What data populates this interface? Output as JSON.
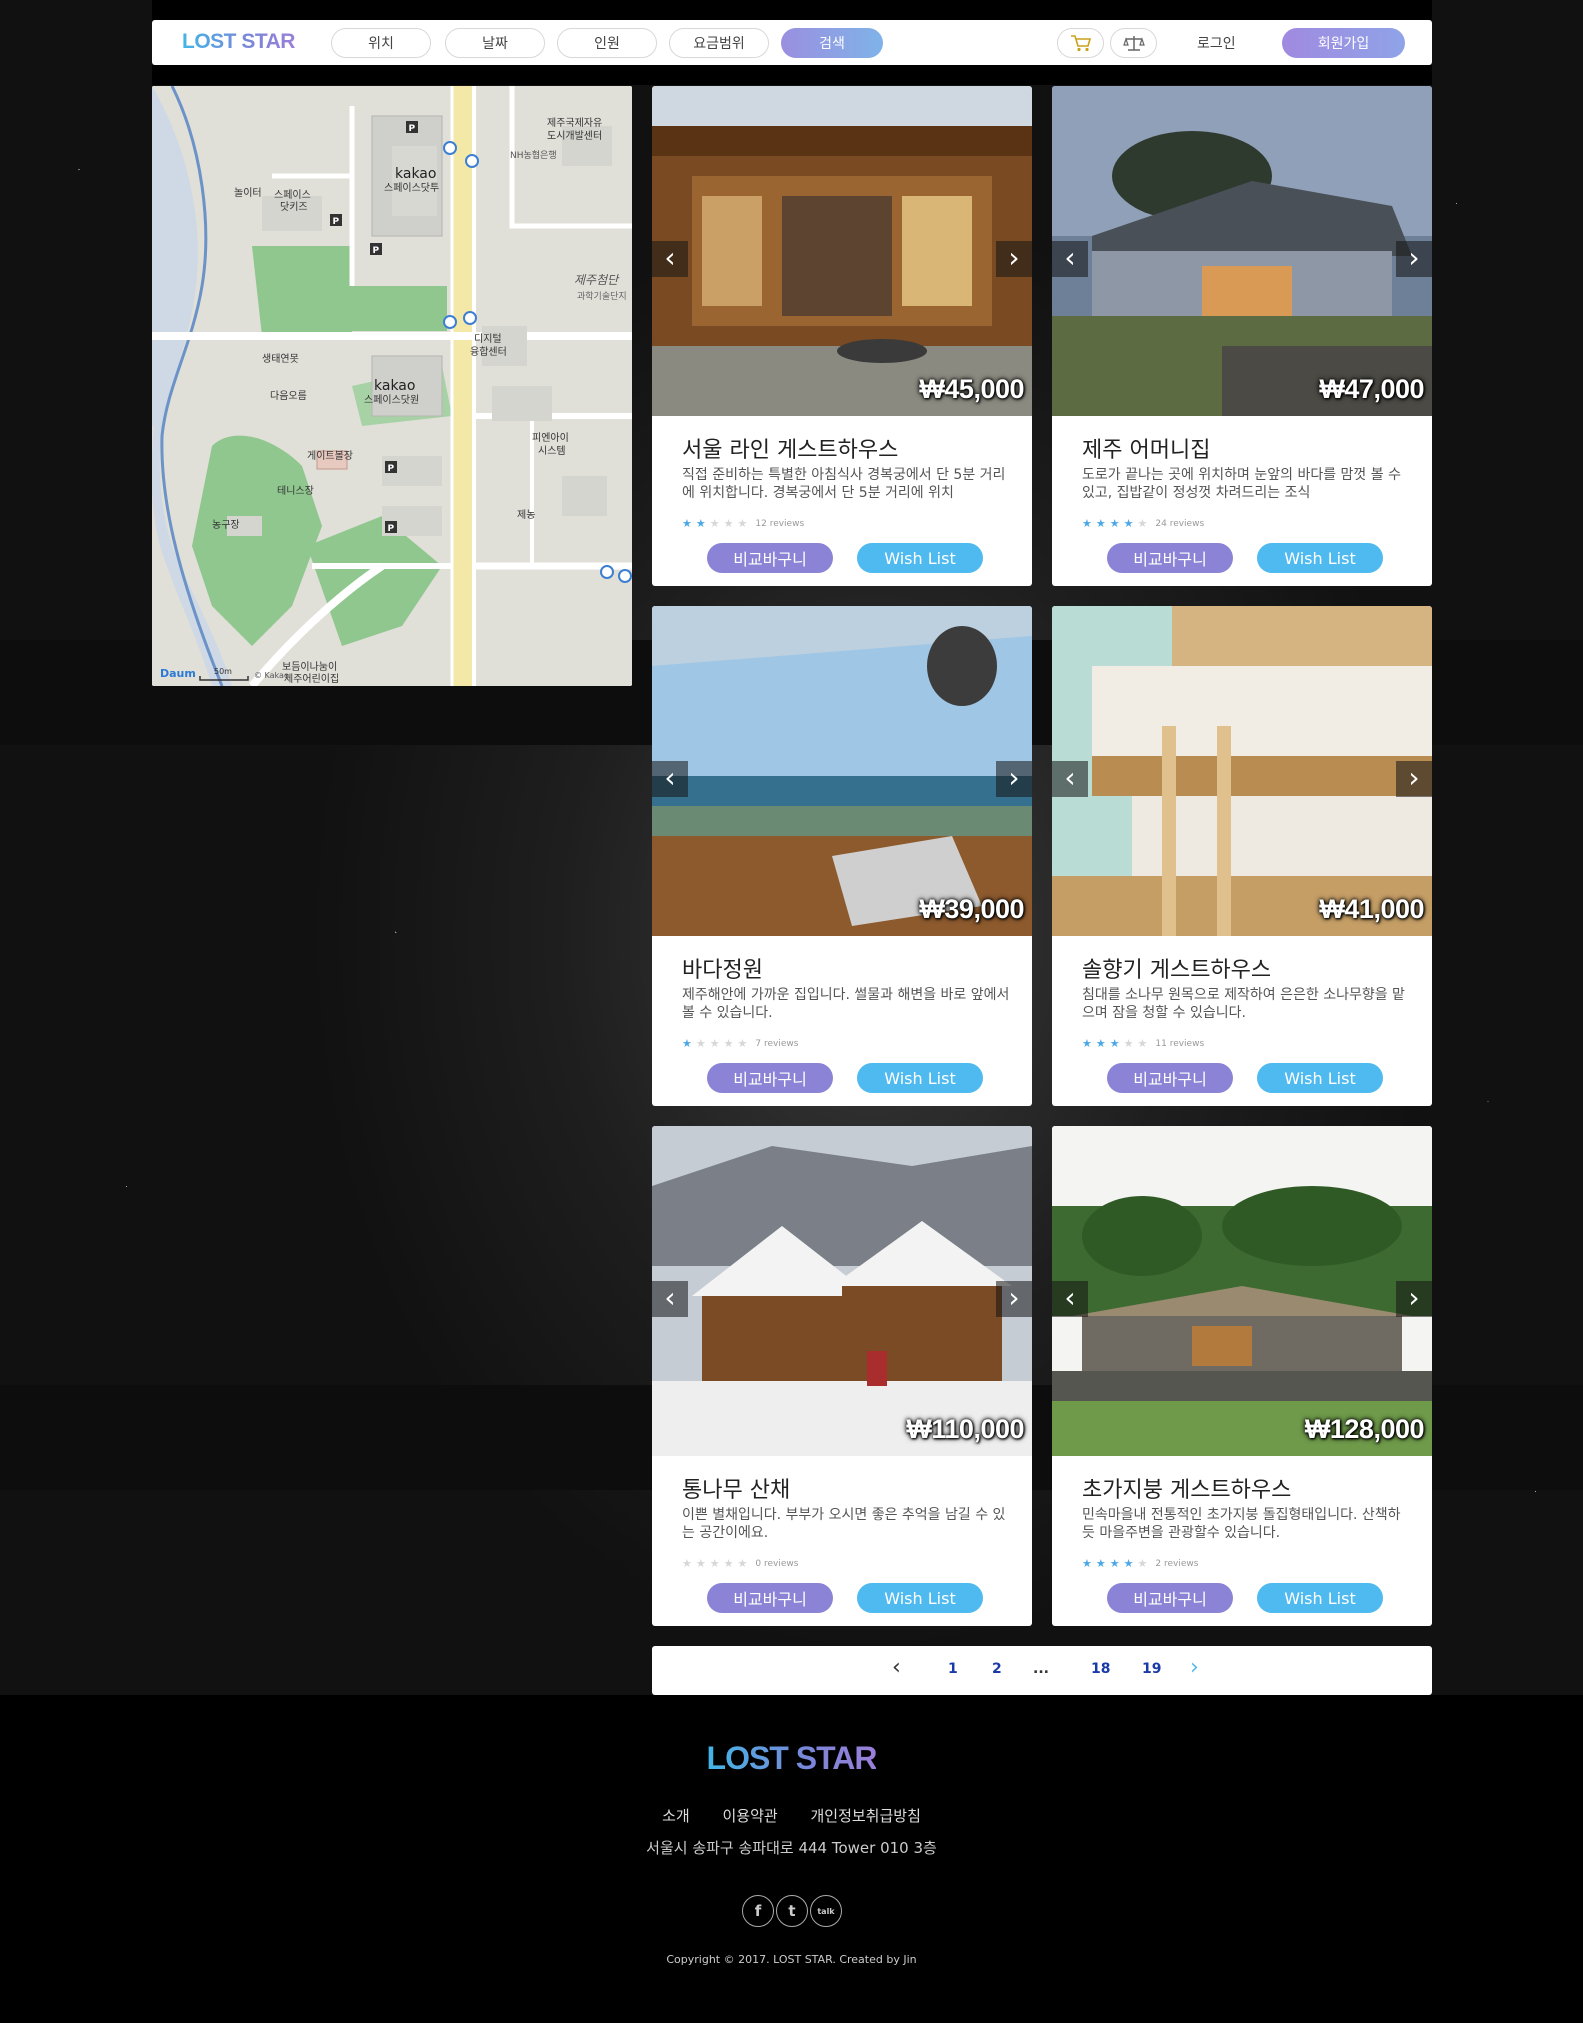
{
  "header": {
    "logo": "LOST STAR",
    "nav": [
      "위치",
      "날짜",
      "인원",
      "요금범위"
    ],
    "search_label": "검색",
    "login_label": "로그인",
    "signup_label": "회원가입"
  },
  "map": {
    "labels": {
      "l1": "제주국제자유",
      "l2": "도시개발센터",
      "l3": "NH농협은행",
      "l4": "kakao",
      "l5": "스페이스닷투",
      "l6": "놀이터",
      "l7": "스페이스",
      "l8": "닷키즈",
      "l9": "제주첨단",
      "l10": "과학기술단지",
      "l11": "생태연못",
      "l12": "디지털",
      "l13": "융합센터",
      "l14": "다음오름",
      "l15": "kakao",
      "l16": "스페이스닷원",
      "l17": "피엔아이",
      "l18": "시스템",
      "l19": "게이트볼장",
      "l20": "테니스장",
      "l21": "제농",
      "l22": "농구장",
      "l23": "보듬이나눔이",
      "l24": "제주어린이집",
      "scale": "50m",
      "brand": "Daum",
      "copyright": "© Kakao"
    }
  },
  "listings": [
    {
      "title": "서울 라인 게스트하우스",
      "desc": "직접 준비하는 특별한 아침식사 경복궁에서 단 5분 거리에 위치합니다. 경복궁에서 단 5분 거리에 위치",
      "price": "₩45,000",
      "stars": 2,
      "reviews": "12 reviews",
      "compare": "비교바구니",
      "wish": "Wish List"
    },
    {
      "title": "제주 어머니집",
      "desc": "도로가 끝나는 곳에 위치하며 눈앞의 바다를 맘껏 볼 수 있고, 집밥같이 정성껏 차려드리는 조식",
      "price": "₩47,000",
      "stars": 4,
      "reviews": "24 reviews",
      "compare": "비교바구니",
      "wish": "Wish List"
    },
    {
      "title": "바다정원",
      "desc": "제주해안에 가까운 집입니다. 썰물과 해변을 바로 앞에서 볼 수 있습니다.",
      "price": "₩39,000",
      "stars": 1,
      "reviews": "7 reviews",
      "compare": "비교바구니",
      "wish": "Wish List"
    },
    {
      "title": "솔향기 게스트하우스",
      "desc": "침대를 소나무 원목으로 제작하여 은은한 소나무향을 맡으며 잠을 청할 수 있습니다.",
      "price": "₩41,000",
      "stars": 3,
      "reviews": "11 reviews",
      "compare": "비교바구니",
      "wish": "Wish List"
    },
    {
      "title": "통나무 산채",
      "desc": "이쁜 별채입니다. 부부가 오시면 좋은 추억을 남길 수 있는 공간이에요.",
      "price": "₩110,000",
      "stars": 0,
      "reviews": "0 reviews",
      "compare": "비교바구니",
      "wish": "Wish List"
    },
    {
      "title": "초가지붕 게스트하우스",
      "desc": "민속마을내 전통적인 초가지붕 돌집형태입니다. 산책하듯 마을주변을 관광할수 있습니다.",
      "price": "₩128,000",
      "stars": 4,
      "reviews": "2 reviews",
      "compare": "비교바구니",
      "wish": "Wish List"
    }
  ],
  "pagination": {
    "pages": [
      "1",
      "2",
      "...",
      "18",
      "19"
    ]
  },
  "footer": {
    "logo": "LOST STAR",
    "links": [
      "소개",
      "이용약관",
      "개인정보취급방침"
    ],
    "address": "서울시 송파구 송파대로 444 Tower 010 3층",
    "social": [
      "f",
      "t",
      "talk"
    ],
    "copyright": "Copyright © 2017. LOST STAR. Created by Jin"
  },
  "colors": {
    "compare_button": "#8b84d6",
    "wish_button": "#4ebaf0",
    "star_on": "#4ba8e8",
    "page_link": "#1a3aa8"
  }
}
